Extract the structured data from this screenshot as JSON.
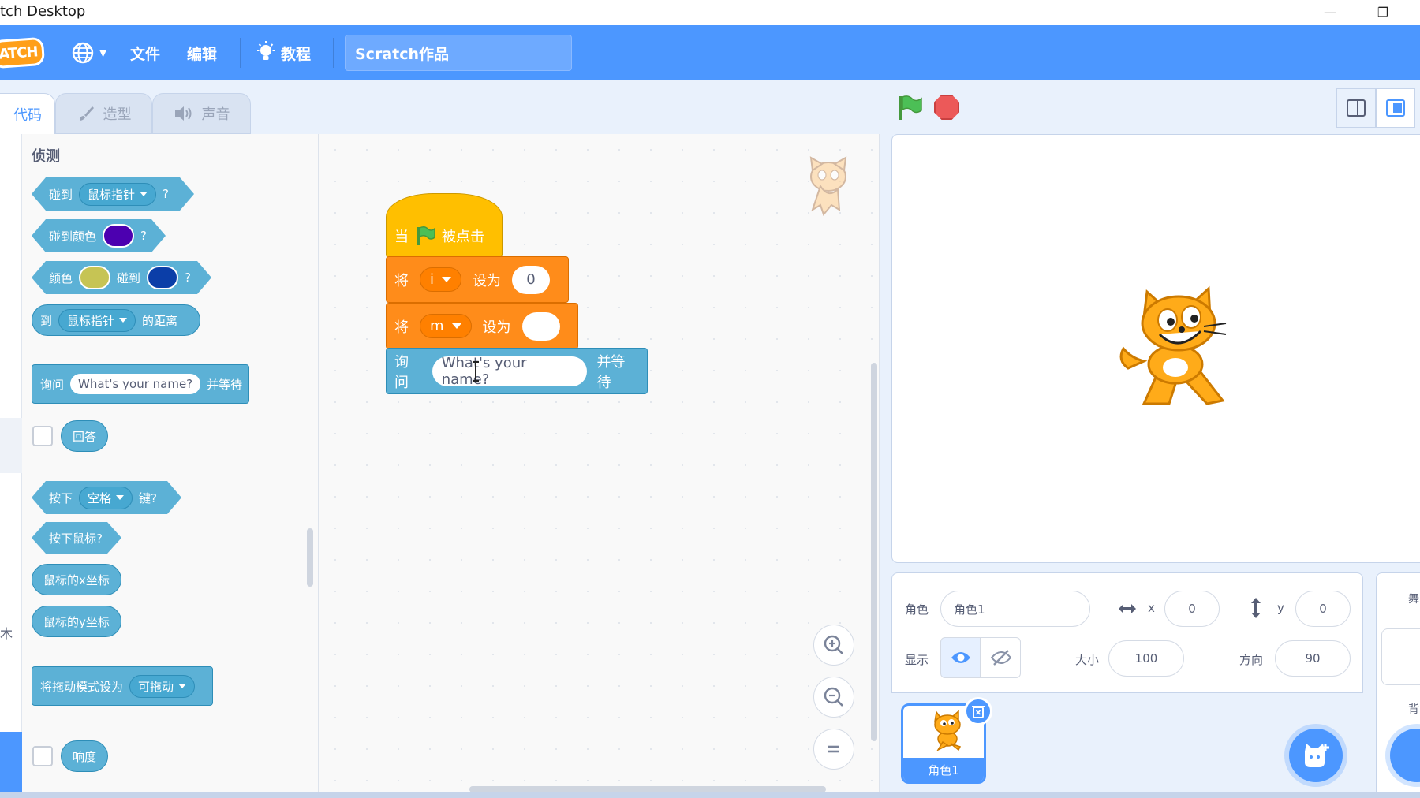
{
  "window": {
    "title": "tch Desktop"
  },
  "menu": {
    "logo_text": "ATCH",
    "file": "文件",
    "edit": "编辑",
    "tutorials": "教程",
    "project_title": "Scratch作品"
  },
  "tabs": {
    "code": "代码",
    "costumes": "造型",
    "sounds": "声音"
  },
  "palette": {
    "category": "侦测",
    "touching": "碰到",
    "touching_target": "鼠标指针",
    "q": "?",
    "touching_color": "碰到颜色",
    "color_label": "颜色",
    "color_touching": "碰到",
    "distance_to": "到",
    "distance_target": "鼠标指针",
    "distance_suffix": "的距离",
    "ask": "询问",
    "ask_default": "What's your name?",
    "ask_wait": "并等待",
    "answer": "回答",
    "key_pressed": "按下",
    "key_name": "空格",
    "key_suffix": "键?",
    "mouse_down": "按下鼠标?",
    "mouse_x": "鼠标的x坐标",
    "mouse_y": "鼠标的y坐标",
    "drag_mode": "将拖动模式设为",
    "drag_value": "可拖动",
    "loudness": "响度",
    "strip_char": "木"
  },
  "script": {
    "hat_when": "当",
    "hat_clicked": "被点击",
    "set1_label": "将",
    "set1_var": "i",
    "set1_to": "设为",
    "set1_value": "0",
    "set2_label": "将",
    "set2_var": "m",
    "set2_to": "设为",
    "set2_value": "",
    "ask_label": "询问",
    "ask_value": "What's your name?",
    "ask_wait": "并等待"
  },
  "sprite_info": {
    "sprite_label": "角色",
    "sprite_name": "角色1",
    "x_label": "x",
    "x_value": "0",
    "y_label": "y",
    "y_value": "0",
    "show_label": "显示",
    "size_label": "大小",
    "size_value": "100",
    "direction_label": "方向",
    "direction_value": "90"
  },
  "sprite_list": {
    "thumb_name": "角色1"
  },
  "backdrop": {
    "title": "舞",
    "label": "背"
  },
  "colors": {
    "accent": "#4c97ff",
    "sensing": "#5cb1d6",
    "variables": "#ff8c1a",
    "events": "#ffbf00",
    "swatch_purple": "#4c00b0",
    "swatch_yellow": "#c6c454",
    "swatch_blue": "#0b3ea8"
  }
}
